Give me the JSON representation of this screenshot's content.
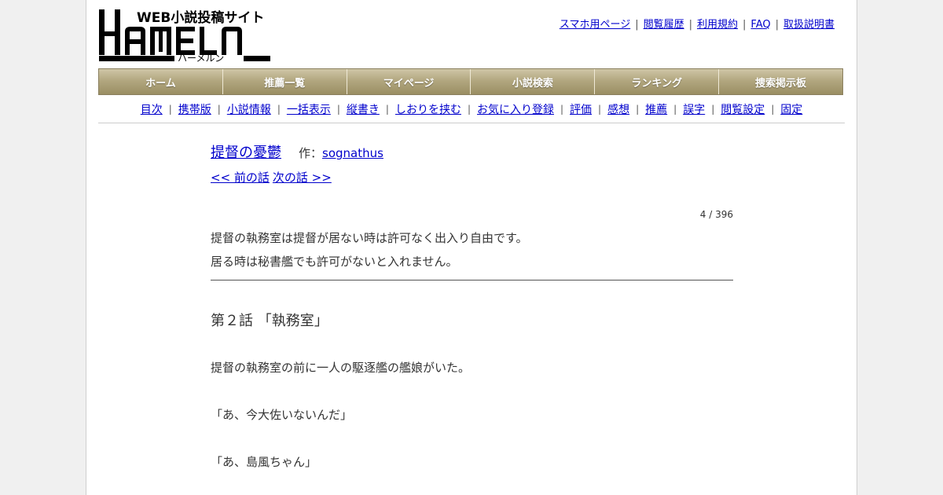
{
  "logo": {
    "tagline": "WEB小説投稿サイト",
    "wordmark": "HAMELN",
    "kana": "ハーメルン"
  },
  "top_links": [
    "スマホ用ページ",
    "閲覧履歴",
    "利用規約",
    "FAQ",
    "取扱説明書"
  ],
  "main_nav": [
    "ホーム",
    "推薦一覧",
    "マイページ",
    "小説検索",
    "ランキング",
    "捜索掲示板"
  ],
  "sub_nav": [
    "目次",
    "携帯版",
    "小説情報",
    "一括表示",
    "縦書き",
    "しおりを挟む",
    "お気に入り登録",
    "評価",
    "感想",
    "推薦",
    "誤字",
    "閲覧設定",
    "固定"
  ],
  "novel": {
    "title": "提督の憂鬱",
    "author_prefix": "作：",
    "author": "sognathus",
    "prev_link": "<< 前の話",
    "next_link": "次の話 >>",
    "page_count": "4 / 396",
    "preface": [
      "提督の執務室は提督が居ない時は許可なく出入り自由です。",
      "居る時は秘書艦でも許可がないと入れません。"
    ],
    "chapter_title": "第２話 「執務室」",
    "body": [
      "提督の執務室の前に一人の駆逐艦の艦娘がいた。",
      "「あ、今大佐いないんだ」",
      "「あ、島風ちゃん」"
    ]
  }
}
